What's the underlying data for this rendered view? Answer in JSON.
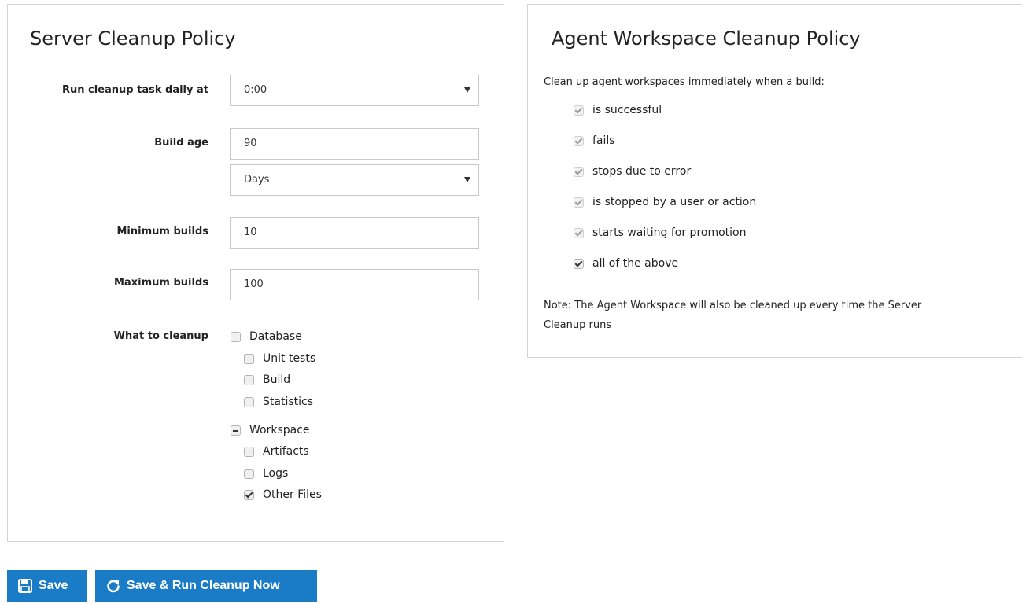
{
  "server": {
    "title": "Server Cleanup Policy",
    "run_label": "Run cleanup task daily at",
    "run_value": "0:00",
    "build_age_label": "Build age",
    "build_age_value": "90",
    "build_age_unit": "Days",
    "min_builds_label": "Minimum builds",
    "min_builds_value": "10",
    "max_builds_label": "Maximum builds",
    "max_builds_value": "100",
    "what_label": "What to cleanup",
    "database_label": "Database",
    "unit_tests_label": "Unit tests",
    "build_label": "Build",
    "statistics_label": "Statistics",
    "workspace_label": "Workspace",
    "artifacts_label": "Artifacts",
    "logs_label": "Logs",
    "other_files_label": "Other Files"
  },
  "agent": {
    "title": "Agent Workspace Cleanup Policy",
    "intro": "Clean up agent workspaces immediately when a build:",
    "options": [
      {
        "label": "is successful",
        "checked": true,
        "disabled": true
      },
      {
        "label": "fails",
        "checked": true,
        "disabled": true
      },
      {
        "label": "stops due to error",
        "checked": true,
        "disabled": true
      },
      {
        "label": "is stopped by a user or action",
        "checked": true,
        "disabled": true
      },
      {
        "label": "starts waiting for promotion",
        "checked": true,
        "disabled": true
      },
      {
        "label": "all of the above",
        "checked": true,
        "disabled": false
      }
    ],
    "note_line1": "Note: The Agent Workspace will also be cleaned up every time the Server",
    "note_line2": "Cleanup runs"
  },
  "actions": {
    "save_label": "Save",
    "save_run_label": "Save & Run Cleanup Now",
    "save_icon": "floppy-disk-icon",
    "save_run_icon": "refresh-icon",
    "button_color": "#1a7cc7"
  }
}
